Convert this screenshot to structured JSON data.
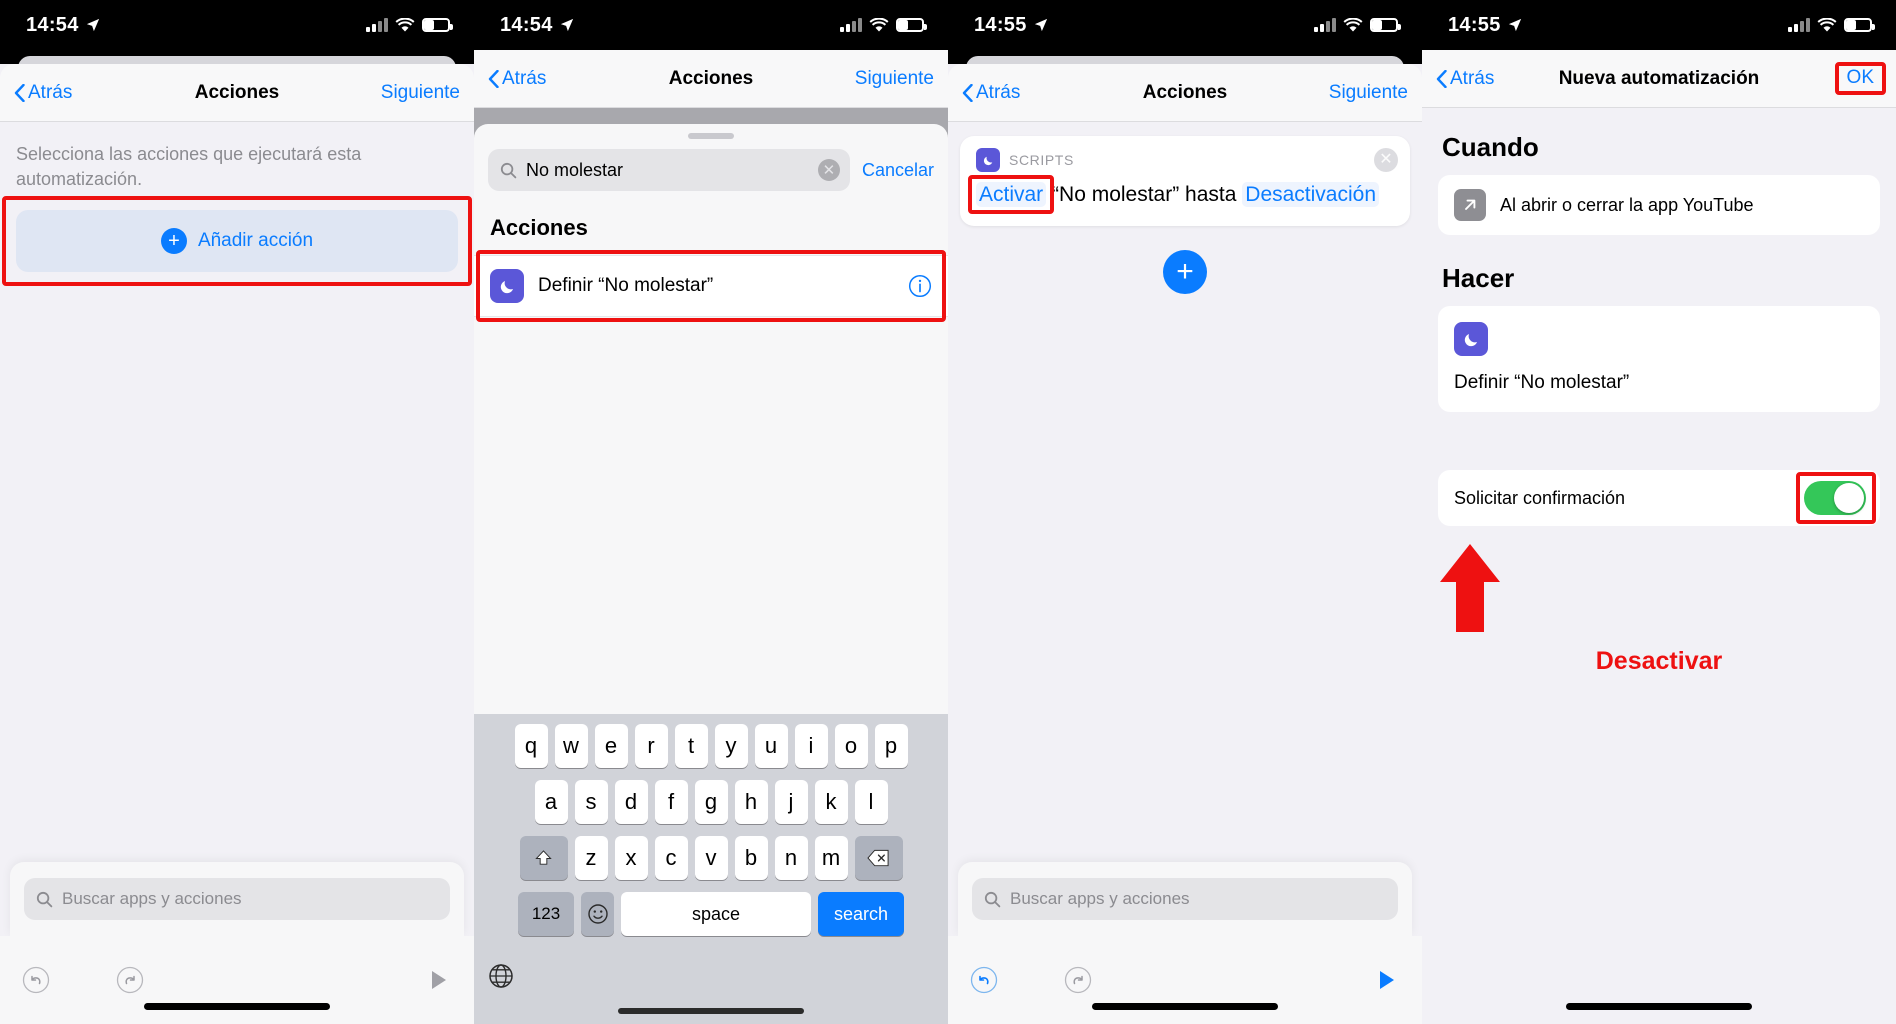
{
  "panels": [
    {
      "status": {
        "time": "14:54",
        "location_icon": "location-arrow-icon",
        "signal_icon": "cellular-bars-icon",
        "wifi_icon": "wifi-icon",
        "battery_icon": "battery-icon"
      },
      "nav": {
        "back": "Atrás",
        "title": "Acciones",
        "right": "Siguiente"
      },
      "description": "Selecciona las acciones que ejecutará esta automatización.",
      "add_action": "Añadir acción",
      "dock_search_placeholder": "Buscar apps y acciones",
      "toolbar": {
        "undo": "undo-icon",
        "redo": "redo-icon",
        "play": "play-icon"
      }
    },
    {
      "status": {
        "time": "14:54"
      },
      "nav": {
        "back": "Atrás",
        "title": "Acciones",
        "right": "Siguiente"
      },
      "search_value": "No molestar",
      "cancel": "Cancelar",
      "section_header": "Acciones",
      "result": {
        "label": "Definir “No molestar”",
        "icon": "moon-icon",
        "info": "info-icon"
      },
      "keyboard": {
        "row1": [
          "q",
          "w",
          "e",
          "r",
          "t",
          "y",
          "u",
          "i",
          "o",
          "p"
        ],
        "row2": [
          "a",
          "s",
          "d",
          "f",
          "g",
          "h",
          "j",
          "k",
          "l"
        ],
        "row3": [
          "z",
          "x",
          "c",
          "v",
          "b",
          "n",
          "m"
        ],
        "shift": "shift-icon",
        "backspace": "backspace-icon",
        "numbers": "123",
        "emoji": "emoji-icon",
        "space": "space",
        "search": "search",
        "globe": "globe-icon"
      }
    },
    {
      "status": {
        "time": "14:55"
      },
      "nav": {
        "back": "Atrás",
        "title": "Acciones",
        "right": "Siguiente"
      },
      "card": {
        "app": "SCRIPTS",
        "token1": "Activar",
        "middle": "“No molestar” hasta",
        "token2": "Desactivación",
        "close": "close-icon"
      },
      "add_button": "+",
      "dock_search_placeholder": "Buscar apps y acciones",
      "toolbar": {
        "undo": "undo-icon",
        "redo": "redo-icon",
        "play": "play-icon"
      }
    },
    {
      "status": {
        "time": "14:55"
      },
      "nav": {
        "back": "Atrás",
        "title": "Nueva automatización",
        "right": "OK"
      },
      "when_title": "Cuando",
      "when_row": {
        "label": "Al abrir o cerrar la app YouTube",
        "icon": "arrow-up-right-icon"
      },
      "do_title": "Hacer",
      "do_row": {
        "label": "Definir “No molestar”",
        "icon": "moon-icon"
      },
      "confirm_label": "Solicitar confirmación",
      "confirm_on": true,
      "annotation": "Desactivar"
    }
  ],
  "colors": {
    "accent_blue": "#0a7cff",
    "highlight_red": "#ee1111",
    "purple_app": "#5b57d8",
    "toggle_green": "#34c759",
    "page_bg": "#f2f1f6"
  }
}
